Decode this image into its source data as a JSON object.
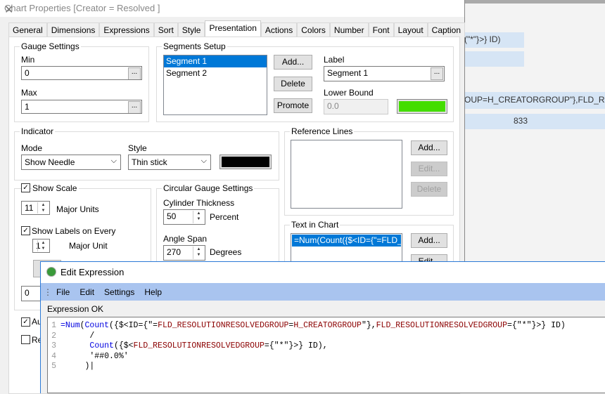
{
  "background": {
    "rows": [
      "(\"*\"}>} ID)",
      "",
      "OUP=H_CREATORGROUP\"},FLD_RE",
      "833"
    ]
  },
  "dialog": {
    "title": "Chart Properties [Creator = Resolved ]",
    "tabs": [
      "General",
      "Dimensions",
      "Expressions",
      "Sort",
      "Style",
      "Presentation",
      "Actions",
      "Colors",
      "Number",
      "Font",
      "Layout",
      "Caption"
    ],
    "active_tab": "Presentation",
    "gauge": {
      "title": "Gauge Settings",
      "min_label": "Min",
      "min": "0",
      "max_label": "Max",
      "max": "1",
      "browse": "..."
    },
    "segments": {
      "title": "Segments Setup",
      "items": [
        "Segment 1",
        "Segment 2"
      ],
      "add": "Add...",
      "delete": "Delete",
      "promote": "Promote",
      "label_label": "Label",
      "label": "Segment 1",
      "lower_bound_label": "Lower Bound",
      "lower_bound": "0.0",
      "color": "#44dd00"
    },
    "indicator": {
      "title": "Indicator",
      "mode_label": "Mode",
      "mode": "Show Needle",
      "style_label": "Style",
      "style": "Thin stick",
      "color": "#000000"
    },
    "reference_lines": {
      "title": "Reference Lines",
      "add": "Add...",
      "edit": "Edit...",
      "delete": "Delete"
    },
    "scale": {
      "show_scale": "Show Scale",
      "major_units": "11",
      "major_units_label": "Major Units",
      "show_labels": "Show Labels on Every",
      "label_every": "1",
      "major_unit_label": "Major Unit",
      "bottom_value": "0",
      "auto_label": "Au",
      "re_label": "Re"
    },
    "circular": {
      "title": "Circular Gauge Settings",
      "thickness_label": "Cylinder Thickness",
      "thickness": "50",
      "percent": "Percent",
      "angle_label": "Angle Span",
      "angle": "270",
      "degrees": "Degrees"
    },
    "text_in_chart": {
      "title": "Text in Chart",
      "item": "=Num(Count({$<ID={\"=FLD_RESOLUTIONRESOLVEDGROUP=H_CREATORGROUP\"},FLD_RESOLUTIONRESOLVEDGROUP={\"*\"}>} ID)",
      "add": "Add...",
      "edit": "Edit..."
    }
  },
  "edit_expression": {
    "title": "Edit Expression",
    "menu": [
      "File",
      "Edit",
      "Settings",
      "Help"
    ],
    "status": "Expression OK",
    "lines": [
      [
        {
          "t": "=",
          "c": "kw"
        },
        {
          "t": "Num",
          "c": "kw"
        },
        {
          "t": "(",
          "c": ""
        },
        {
          "t": "Count",
          "c": "kw"
        },
        {
          "t": "({$<ID={\"=",
          "c": ""
        },
        {
          "t": "FLD_RESOLUTIONRESOLVEDGROUP",
          "c": "fld"
        },
        {
          "t": "=",
          "c": ""
        },
        {
          "t": "H_CREATORGROUP",
          "c": "fld"
        },
        {
          "t": "\"},",
          "c": ""
        },
        {
          "t": "FLD_RESOLUTIONRESOLVEDGROUP",
          "c": "fld"
        },
        {
          "t": "={\"*\"}>} ID)",
          "c": ""
        }
      ],
      [
        {
          "t": "      /",
          "c": ""
        }
      ],
      [
        {
          "t": "      ",
          "c": ""
        },
        {
          "t": "Count",
          "c": "kw"
        },
        {
          "t": "({$<",
          "c": ""
        },
        {
          "t": "FLD_RESOLUTIONRESOLVEDGROUP",
          "c": "fld"
        },
        {
          "t": "={\"*\"}>} ID),",
          "c": ""
        }
      ],
      [
        {
          "t": "      '##0.0%'",
          "c": ""
        }
      ],
      [
        {
          "t": "     )",
          "c": ""
        }
      ]
    ],
    "accent": "#a9c4ef"
  }
}
